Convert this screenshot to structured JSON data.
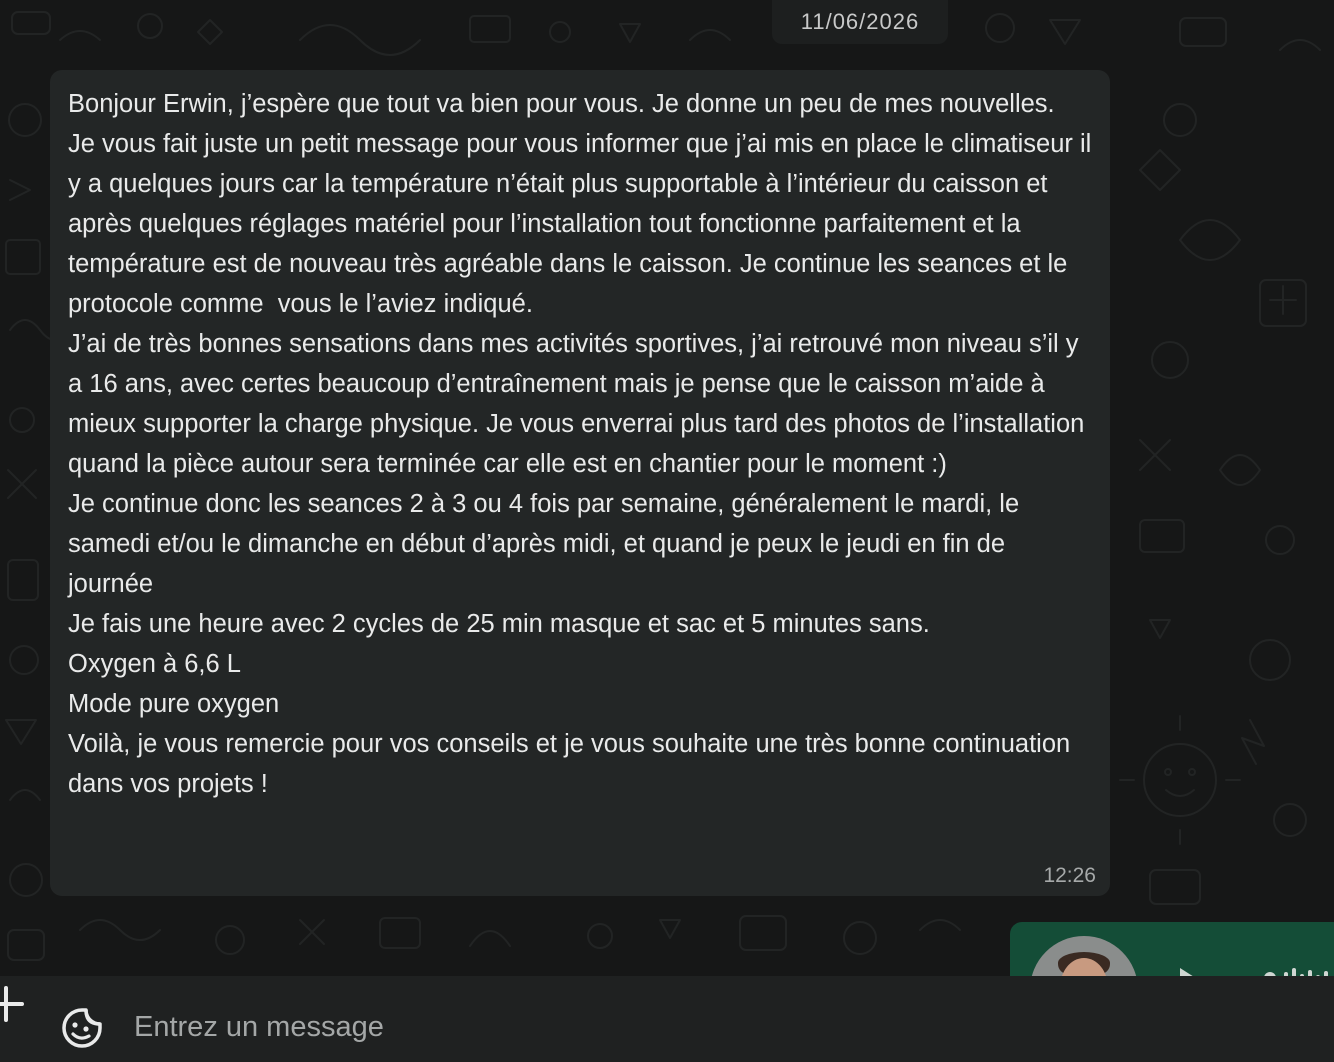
{
  "chat": {
    "date_separator": "11/06/2026",
    "incoming_message": {
      "text": "Bonjour Erwin, j’espère que tout va bien pour vous. Je donne un peu de mes nouvelles.\nJe vous fait juste un petit message pour vous informer que j’ai mis en place le climatiseur il y a quelques jours car la température n’était plus supportable à l’intérieur du caisson et après quelques réglages matériel pour l’installation tout fonctionne parfaitement et la température est de nouveau très agréable dans le caisson. Je continue les seances et le protocole comme  vous le l’aviez indiqué.\nJ’ai de très bonnes sensations dans mes activités sportives, j’ai retrouvé mon niveau s’il y a 16 ans, avec certes beaucoup d’entraînement mais je pense que le caisson m’aide à mieux supporter la charge physique. Je vous enverrai plus tard des photos de l’installation quand la pièce autour sera terminée car elle est en chantier pour le moment :)\nJe continue donc les seances 2 à 3 ou 4 fois par semaine, généralement le mardi, le samedi et/ou le dimanche en début d’après midi, et quand je peux le jeudi en fin de journée\nJe fais une heure avec 2 cycles de 25 min masque et sac et 5 minutes sans.\nOxygen à 6,6 L\nMode pure oxygen\nVoilà, je vous remercie pour vos conseils et je vous souhaite une très bonne continuation dans vos projets !",
      "time": "12:26"
    },
    "outgoing_preview": {
      "type": "voice-note",
      "avatar_icon": "contact-avatar"
    }
  },
  "composer": {
    "placeholder": "Entrez un message",
    "value": "",
    "attach_icon": "plus-icon",
    "sticker_icon": "sticker-icon"
  },
  "colors": {
    "background": "#161717",
    "bubble_incoming": "#232626",
    "bubble_outgoing": "#144d37",
    "composer": "#1f2121",
    "text": "#e9eaea",
    "muted": "#a6a9a9"
  }
}
